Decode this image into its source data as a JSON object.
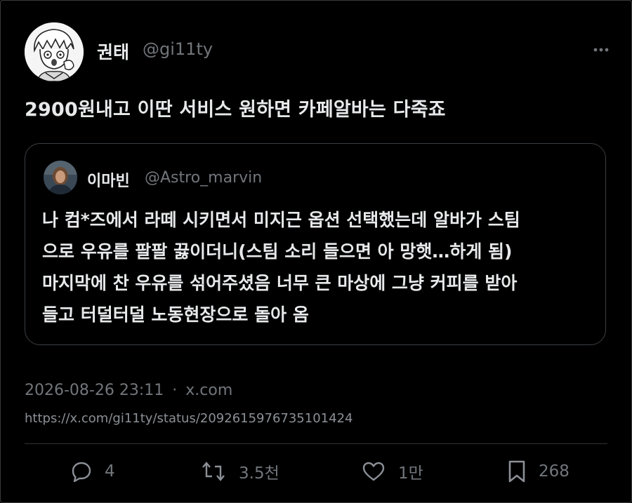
{
  "tweet": {
    "author": {
      "name": "권태",
      "handle": "@gi11ty"
    },
    "text": "2900원내고 이딴 서비스 원하면 카페알바는 다죽죠",
    "quote": {
      "author": {
        "name": "이마빈",
        "handle": "@Astro_marvin"
      },
      "lines": [
        "나 컴*즈에서 라떼 시키면서 미지근 옵션 선택했는데 알바가 스팀",
        "으로 우유를 팔팔 끓이더니(스팀 소리 들으면 아 망햇…하게 됨)",
        "마지막에 찬 우유를 섞어주셨음 너무 큰 마상에 그냥 커피를 받아",
        "들고 터덜터덜 노동현장으로 돌아 옴"
      ]
    },
    "timestamp": "2026-08-26 23:11",
    "separator": "·",
    "source": "x.com",
    "url": "https://x.com/gi11ty/status/2092615976735101424",
    "stats": {
      "replies": "4",
      "retweets": "3.5천",
      "likes": "1만",
      "bookmarks": "268"
    }
  },
  "icons": {
    "more": "more-icon",
    "reply": "reply-icon",
    "retweet": "retweet-icon",
    "like": "heart-icon",
    "bookmark": "bookmark-icon"
  },
  "colors": {
    "background": "#000000",
    "text": "#e7e9ea",
    "muted": "#71767b",
    "border": "#3b3f44"
  }
}
